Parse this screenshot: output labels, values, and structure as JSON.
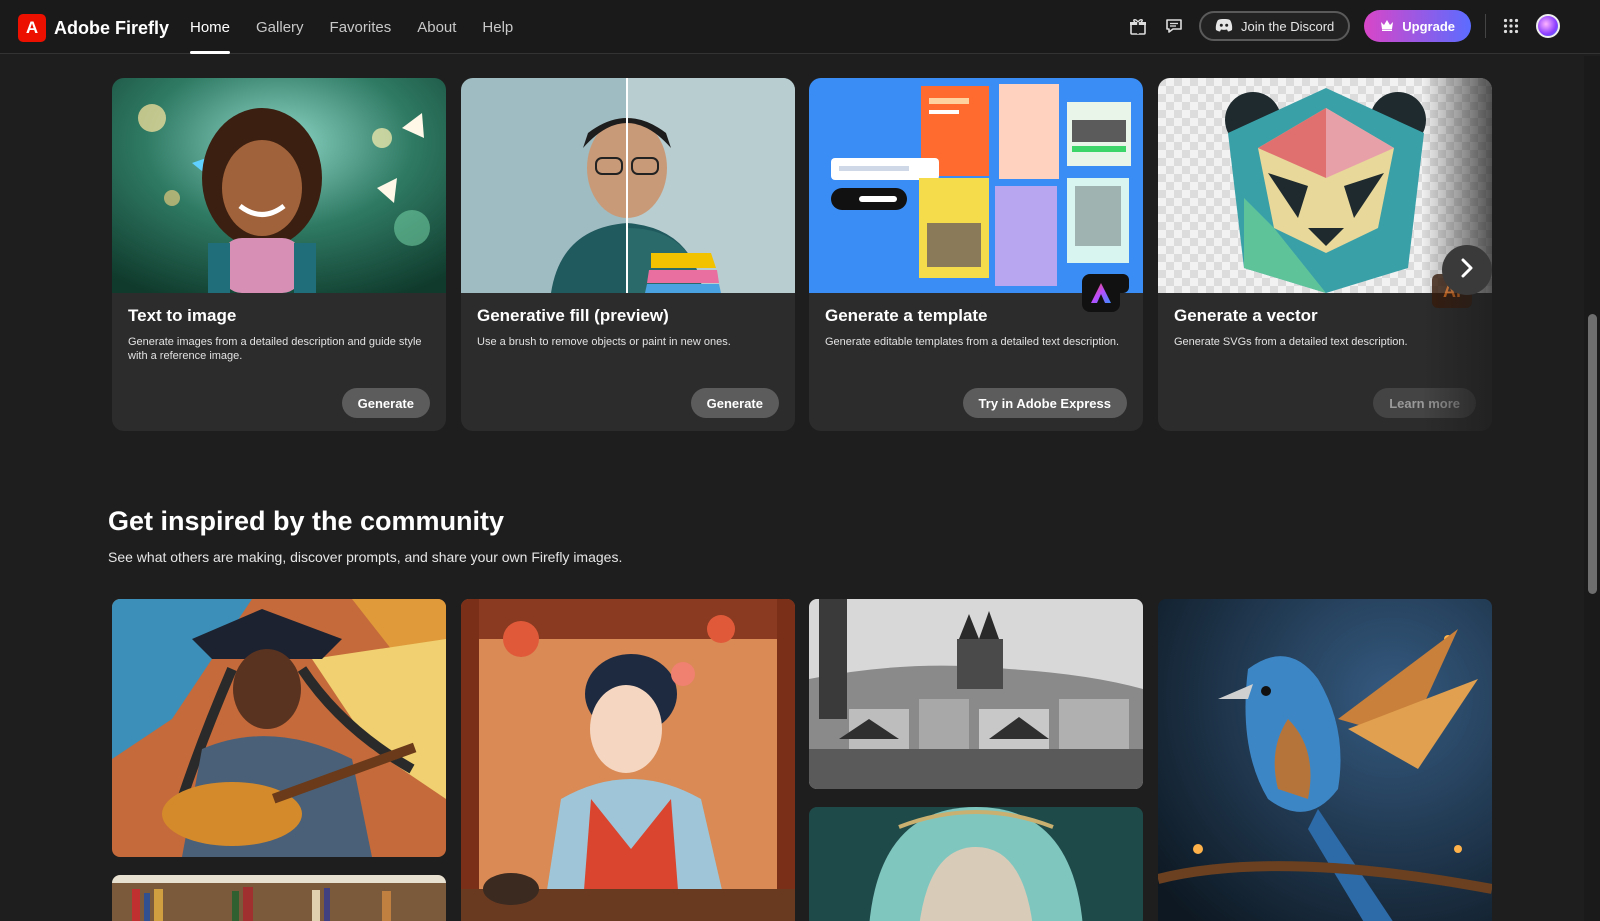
{
  "app": {
    "name": "Adobe Firefly",
    "logo_glyph": "A"
  },
  "nav": {
    "items": [
      {
        "label": "Home",
        "active": true
      },
      {
        "label": "Gallery",
        "active": false
      },
      {
        "label": "Favorites",
        "active": false
      },
      {
        "label": "About",
        "active": false
      },
      {
        "label": "Help",
        "active": false
      }
    ]
  },
  "header": {
    "discord_label": "Join the Discord",
    "upgrade_label": "Upgrade",
    "icons": [
      "gift-icon",
      "chat-icon",
      "discord-icon",
      "crown-icon",
      "apps-grid-icon",
      "avatar"
    ]
  },
  "features": [
    {
      "title": "Text to image",
      "description": "Generate images from a detailed description and guide style with a reference image.",
      "button": "Generate"
    },
    {
      "title": "Generative fill (preview)",
      "description": "Use a brush to remove objects or paint in new ones.",
      "button": "Generate"
    },
    {
      "title": "Generate a template",
      "description": "Generate editable templates from a detailed text description.",
      "button": "Try in Adobe Express"
    },
    {
      "title": "Generate a vector",
      "description": "Generate SVGs from a detailed text description.",
      "button": "Learn more",
      "badge": "Ai"
    }
  ],
  "community": {
    "title": "Get inspired by the community",
    "subtitle": "See what others are making, discover prompts, and share your own Firefly images."
  },
  "colors": {
    "background": "#1e1e1e",
    "card": "#2c2c2c",
    "brand_red": "#eb1000",
    "upgrade_gradient_start": "#d946c8",
    "upgrade_gradient_end": "#5b6cff"
  }
}
